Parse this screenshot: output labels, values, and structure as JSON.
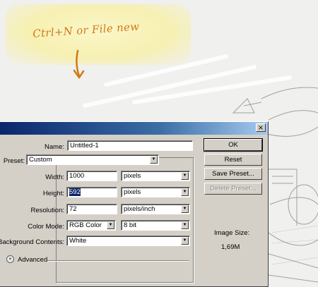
{
  "annotation": {
    "text": "Ctrl+N or File new",
    "color": "#d27a16"
  },
  "dialog": {
    "close_label": "×",
    "name_label": "Name:",
    "name_value": "Untitled-1",
    "preset_label": "Preset:",
    "preset_value": "Custom",
    "width_label": "Width:",
    "width_value": "1000",
    "width_unit": "pixels",
    "height_label": "Height:",
    "height_value": "592",
    "height_unit": "pixels",
    "resolution_label": "Resolution:",
    "resolution_value": "72",
    "resolution_unit": "pixels/inch",
    "color_mode_label": "Color Mode:",
    "color_mode_value": "RGB Color",
    "bit_depth_value": "8 bit",
    "background_label": "Background Contents:",
    "background_value": "White",
    "advanced_label": "Advanced",
    "advanced_icon": "»",
    "buttons": {
      "ok": "OK",
      "reset": "Reset",
      "save_preset": "Save Preset...",
      "delete_preset": "Delete Preset..."
    },
    "image_size_label": "Image Size:",
    "image_size_value": "1,69M",
    "dropdown_arrow": "▼",
    "titlebar_colors": [
      "#0a246a",
      "#a6caf0"
    ]
  }
}
